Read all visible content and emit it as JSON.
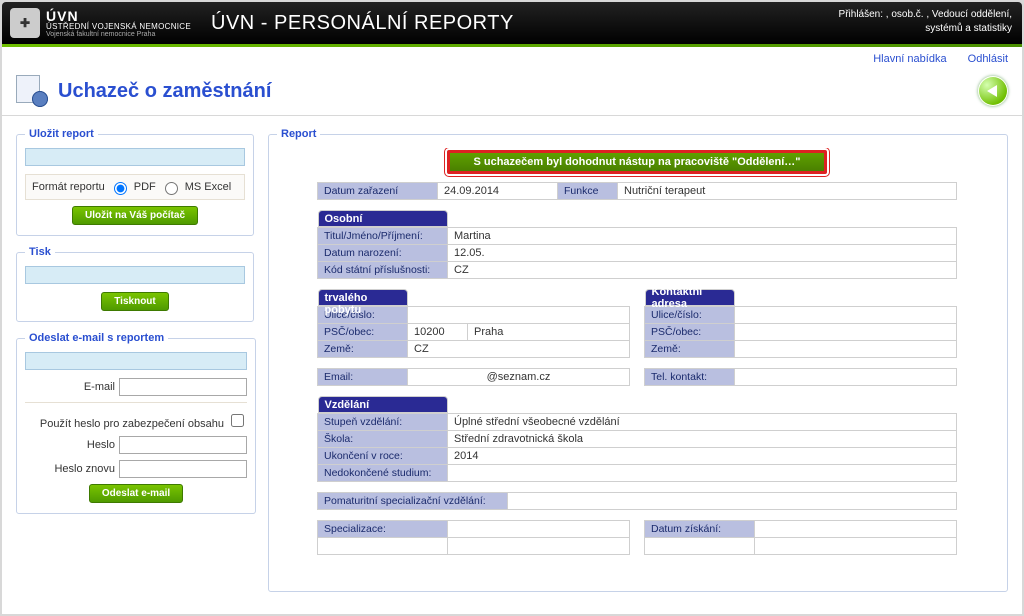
{
  "header": {
    "org_abbrev": "ÚVN",
    "org_line2": "ÚSTŘEDNÍ VOJENSKÁ NEMOCNICE",
    "org_line3": "Vojenská fakultní nemocnice Praha",
    "app_title": "ÚVN - PERSONÁLNÍ REPORTY",
    "login_label": "Přihlášen:",
    "login_user": "",
    "osob_label": ", osob.č.",
    "osob_val": "",
    "role_label": ", Vedoucí oddělení,",
    "role_line2": "systémů a statistiky"
  },
  "topnav": {
    "main_menu": "Hlavní nabídka",
    "logout": "Odhlásit"
  },
  "page_title": "Uchazeč o zaměstnání",
  "left": {
    "save": {
      "legend": "Uložit report",
      "format_label": "Formát reportu",
      "opt_pdf": "PDF",
      "opt_xls": "MS Excel",
      "save_btn": "Uložit na Váš počítač"
    },
    "print": {
      "legend": "Tisk",
      "btn": "Tisknout"
    },
    "mail": {
      "legend": "Odeslat e-mail s reportem",
      "email_label": "E-mail",
      "email_value": "",
      "cb_label": "Použít heslo pro zabezpečení obsahu",
      "pwd_label": "Heslo",
      "pwd2_label": "Heslo znovu",
      "send_btn": "Odeslat e-mail"
    }
  },
  "report": {
    "legend": "Report",
    "notice": "S uchazečem byl dohodnut nástup na pracoviště \"Oddělení…\"",
    "top": {
      "datum_zarazeni_lbl": "Datum zařazení",
      "datum_zarazeni": "24.09.2014",
      "funkce_lbl": "Funkce",
      "funkce": "Nutriční terapeut"
    },
    "osobni": {
      "hdr": "Osobní",
      "titul_lbl": "Titul/Jméno/Příjmení:",
      "titul": "Martina",
      "narozeni_lbl": "Datum narození:",
      "narozeni": "12.05.",
      "kod_lbl": "Kód státní příslušnosti:",
      "kod": "CZ"
    },
    "adresa": {
      "hdr": "Adresa trvalého pobytu",
      "ulice_lbl": "Ulice/číslo:",
      "ulice": "",
      "psc_lbl": "PSČ/obec:",
      "psc": "10200",
      "obec": "Praha",
      "zeme_lbl": "Země:",
      "zeme": "CZ",
      "email_lbl": "Email:",
      "email": "@seznam.cz"
    },
    "kontakt": {
      "hdr": "Kontaktní adresa",
      "ulice_lbl": "Ulice/číslo:",
      "ulice": "",
      "psc_lbl": "PSČ/obec:",
      "psc": "",
      "zeme_lbl": "Země:",
      "zeme": "",
      "tel_lbl": "Tel. kontakt:",
      "tel": ""
    },
    "vzdelani": {
      "hdr": "Vzdělání",
      "stupen_lbl": "Stupeň vzdělání:",
      "stupen": "Úplné střední všeobecné vzdělání",
      "skola_lbl": "Škola:",
      "skola": "Střední zdravotnická škola",
      "ukonceni_lbl": "Ukončení v roce:",
      "ukonceni": "2014",
      "nedok_lbl": "Nedokončené studium:",
      "nedok": "",
      "pomat_lbl": "Pomaturitní specializační vzdělání:",
      "pomat": "",
      "spec_lbl": "Specializace:",
      "spec": "",
      "datum_ziskani_lbl": "Datum získání:",
      "datum_ziskani": ""
    }
  }
}
